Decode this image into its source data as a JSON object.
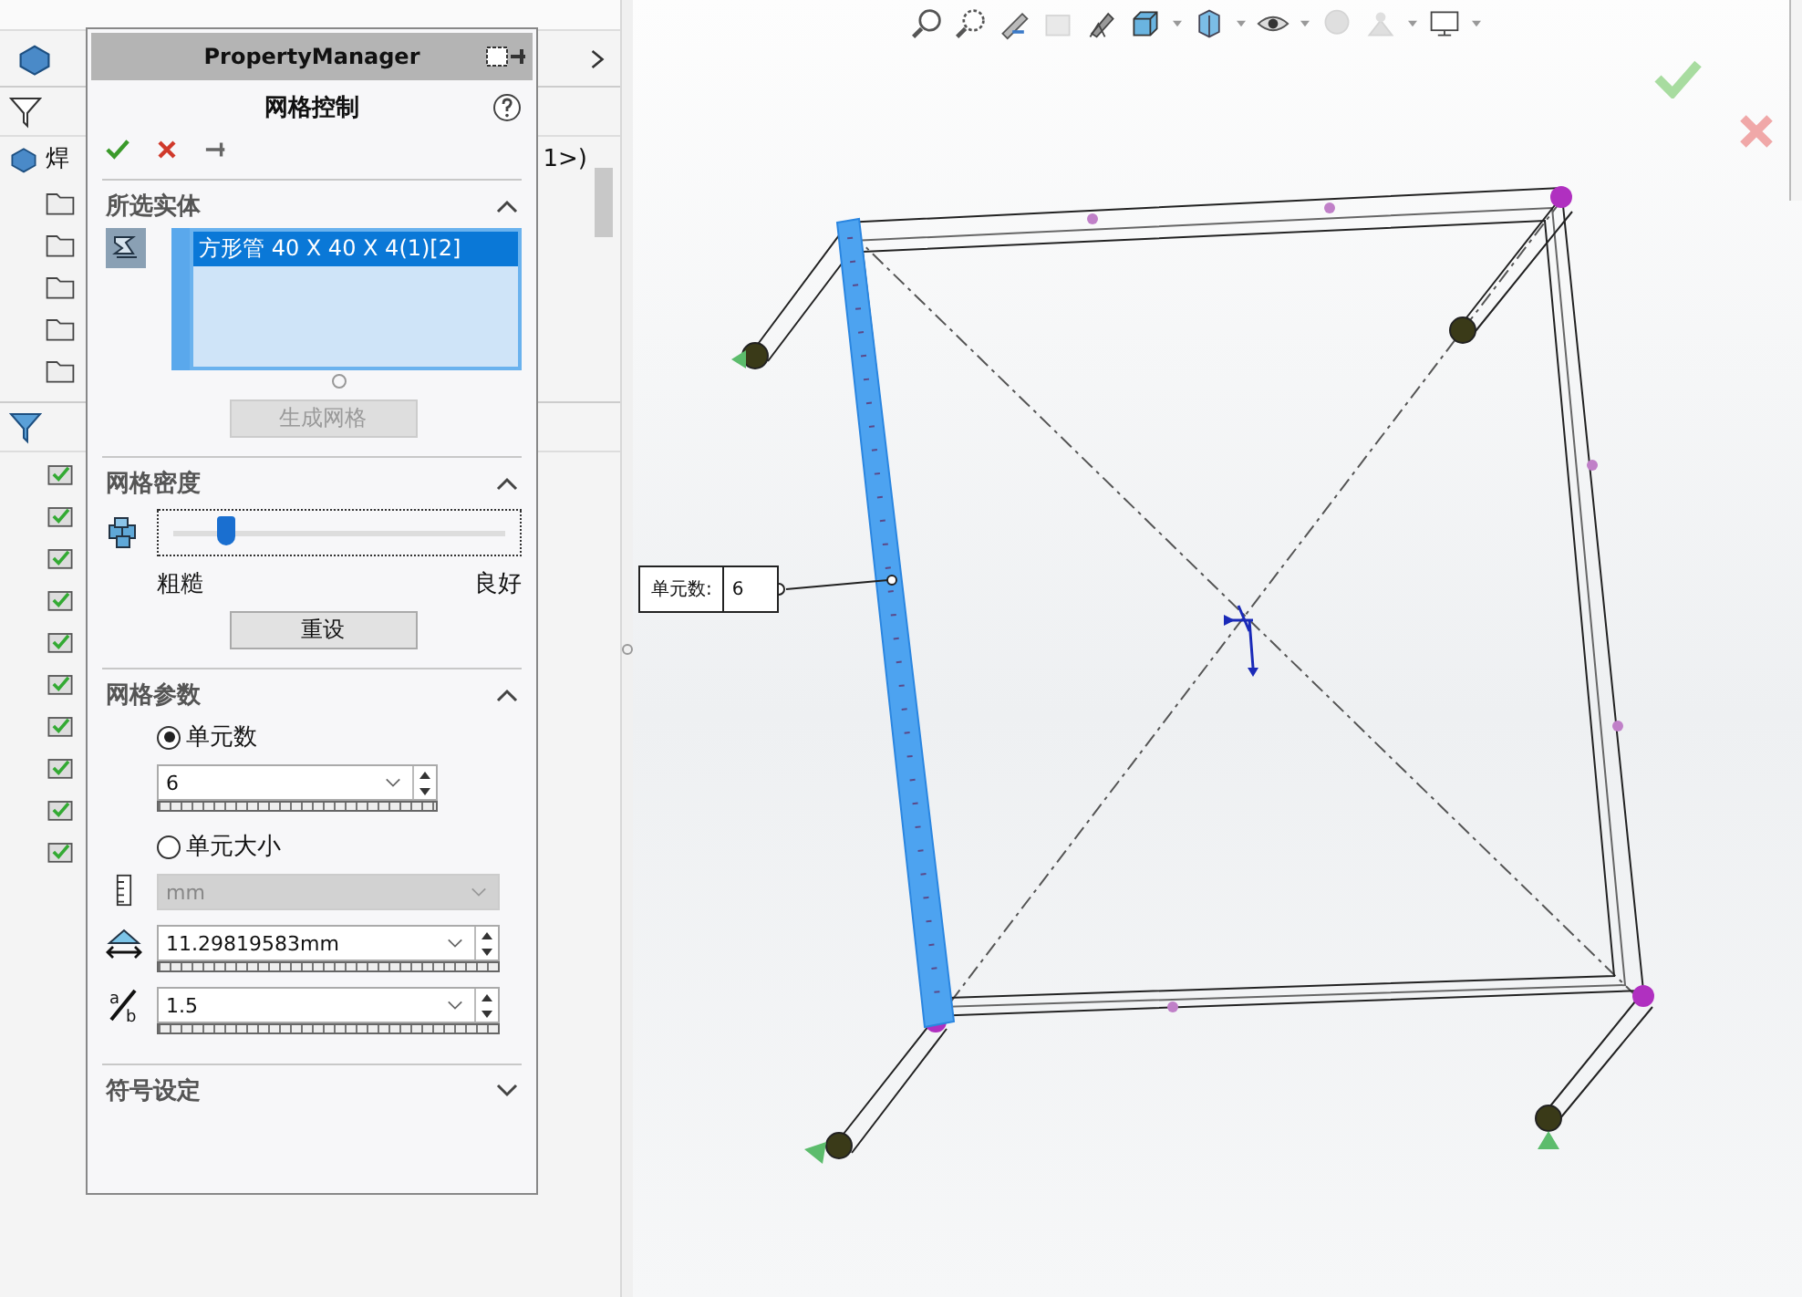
{
  "feature_tree": {
    "root_label": "焊",
    "config_suffix": "1>)"
  },
  "property_manager": {
    "header": "PropertyManager",
    "title": "网格控制",
    "selected_entities": {
      "title": "所选实体",
      "expanded": true,
      "items": [
        {
          "label": "方形管 40 X 40 X 4(1)[2]",
          "selected": true
        }
      ],
      "button": {
        "label": "生成网格",
        "disabled": true
      }
    },
    "mesh_density": {
      "title": "网格密度",
      "expanded": true,
      "level": 0.16,
      "min_label": "粗糙",
      "max_label": "良好",
      "button": "重设"
    },
    "mesh_parameters": {
      "title": "网格参数",
      "expanded": true,
      "options": [
        {
          "label": "单元数",
          "selected": true
        },
        {
          "label": "单元大小",
          "selected": false
        }
      ],
      "element_count": "6",
      "unit": {
        "value": "mm",
        "disabled": true
      },
      "element_size": "11.29819583mm",
      "ratio": "1.5",
      "ratio_icon": {
        "numerator": "a",
        "denominator": "b"
      }
    },
    "symbol_settings": {
      "title": "符号设定",
      "expanded": false
    }
  },
  "viewport": {
    "callout": {
      "label": "单元数:",
      "value": "6"
    }
  }
}
